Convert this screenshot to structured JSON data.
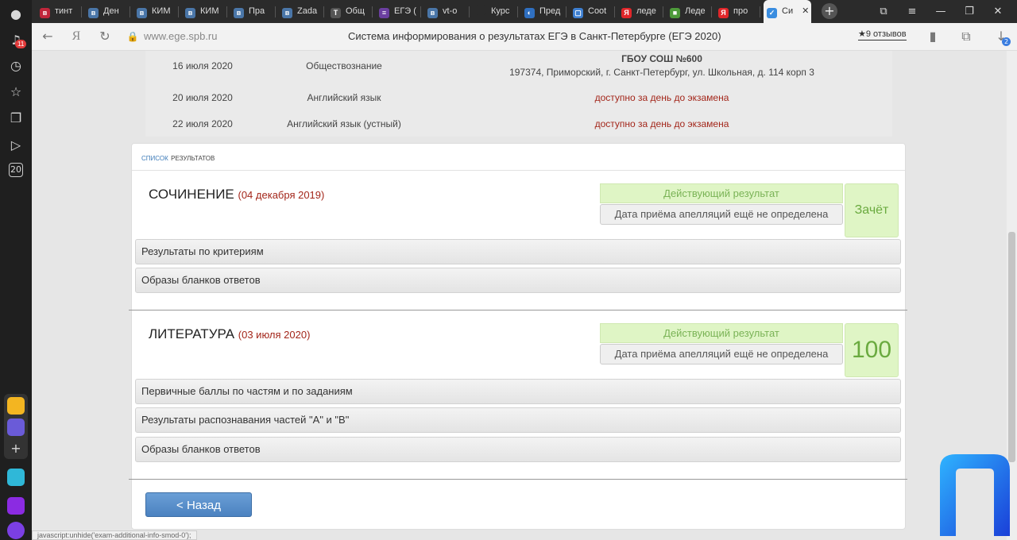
{
  "browser": {
    "tabs": [
      {
        "label": "тинт",
        "icon": "vk-icon",
        "color": "#c0263b"
      },
      {
        "label": "Ден",
        "icon": "vk-icon",
        "color": "#4a76a8"
      },
      {
        "label": "КИМ",
        "icon": "vk-icon",
        "color": "#4a76a8"
      },
      {
        "label": "КИМ",
        "icon": "vk-icon",
        "color": "#4a76a8"
      },
      {
        "label": "Пра",
        "icon": "vk-icon",
        "color": "#4a76a8"
      },
      {
        "label": "Zada",
        "icon": "vk-icon",
        "color": "#4a76a8"
      },
      {
        "label": "Общ",
        "icon": "t-icon",
        "color": "#555555"
      },
      {
        "label": "ЕГЭ (",
        "icon": "list-icon",
        "color": "#6b3fa0"
      },
      {
        "label": "vt-o",
        "icon": "vk-icon",
        "color": "#4a76a8"
      },
      {
        "label": "Курс",
        "icon": "blank-icon",
        "color": "#2b2b2b"
      },
      {
        "label": "Пред",
        "icon": "flag-icon",
        "color": "#2f6fc0"
      },
      {
        "label": "Coot",
        "icon": "chat-icon",
        "color": "#3e7fd0"
      },
      {
        "label": "леде",
        "icon": "yandex-icon",
        "color": "#e0262a"
      },
      {
        "label": "Леде",
        "icon": "box-icon",
        "color": "#4d9a3a"
      },
      {
        "label": "про",
        "icon": "yandex-icon",
        "color": "#e0262a"
      },
      {
        "label": "Си",
        "icon": "check-icon",
        "color": "#3a8de0"
      }
    ],
    "url": "www.ege.spb.ru",
    "page_title": "Система информирования о результатах ЕГЭ в Санкт-Петербурге (ЕГЭ 2020)",
    "reviews": "★9 отзывов",
    "notification_count": "11",
    "download_count": "2",
    "status_text": "javascript:unhide('exam-additional-info-smod-0');"
  },
  "schedule": [
    {
      "date": "16 июля 2020",
      "subject": "Обществознание",
      "place_name": "ГБОУ СОШ №600",
      "place_address": "197374, Приморский, г. Санкт-Петербург, ул. Школьная, д. 114 корп 3"
    },
    {
      "date": "20 июля 2020",
      "subject": "Английский язык",
      "place_note": "доступно за день до экзамена"
    },
    {
      "date": "22 июля 2020",
      "subject": "Английский язык (устный)",
      "place_note": "доступно за день до экзамена"
    }
  ],
  "results": {
    "header_a": "список",
    "header_b": "результатов",
    "exams": [
      {
        "name": "СОЧИНЕНИЕ",
        "date": "(04 декабря 2019)",
        "status": "Действующий результат",
        "appeal": "Дата приёма апелляций ещё не определена",
        "score": "Зачёт",
        "sections": [
          "Результаты по критериям",
          "Образы бланков ответов"
        ]
      },
      {
        "name": "ЛИТЕРАТУРА",
        "date": "(03 июля 2020)",
        "status": "Действующий результат",
        "appeal": "Дата приёма апелляций ещё не определена",
        "score": "100",
        "sections": [
          "Первичные баллы по частям и по заданиям",
          "Результаты распознавания частей \"А\" и \"В\"",
          "Образы бланков ответов"
        ]
      }
    ],
    "back_label": "< Назад"
  }
}
